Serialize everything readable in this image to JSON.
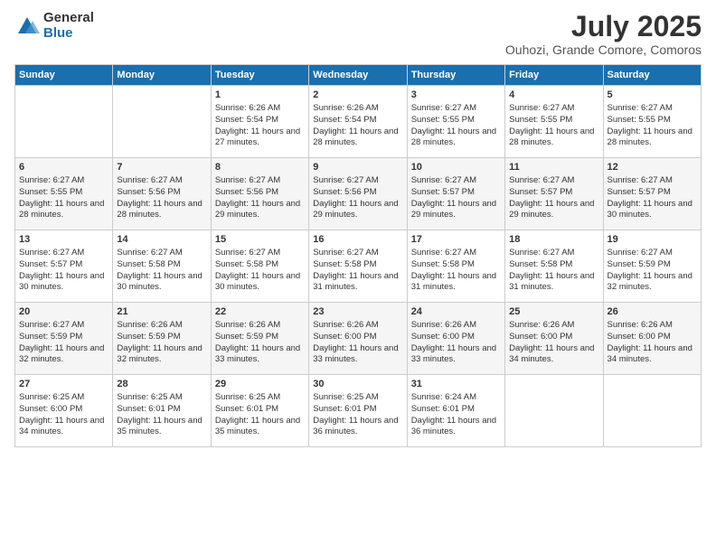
{
  "logo": {
    "general": "General",
    "blue": "Blue"
  },
  "title": "July 2025",
  "subtitle": "Ouhozi, Grande Comore, Comoros",
  "days_of_week": [
    "Sunday",
    "Monday",
    "Tuesday",
    "Wednesday",
    "Thursday",
    "Friday",
    "Saturday"
  ],
  "weeks": [
    [
      {
        "day": "",
        "info": ""
      },
      {
        "day": "",
        "info": ""
      },
      {
        "day": "1",
        "info": "Sunrise: 6:26 AM\nSunset: 5:54 PM\nDaylight: 11 hours and 27 minutes."
      },
      {
        "day": "2",
        "info": "Sunrise: 6:26 AM\nSunset: 5:54 PM\nDaylight: 11 hours and 28 minutes."
      },
      {
        "day": "3",
        "info": "Sunrise: 6:27 AM\nSunset: 5:55 PM\nDaylight: 11 hours and 28 minutes."
      },
      {
        "day": "4",
        "info": "Sunrise: 6:27 AM\nSunset: 5:55 PM\nDaylight: 11 hours and 28 minutes."
      },
      {
        "day": "5",
        "info": "Sunrise: 6:27 AM\nSunset: 5:55 PM\nDaylight: 11 hours and 28 minutes."
      }
    ],
    [
      {
        "day": "6",
        "info": "Sunrise: 6:27 AM\nSunset: 5:55 PM\nDaylight: 11 hours and 28 minutes."
      },
      {
        "day": "7",
        "info": "Sunrise: 6:27 AM\nSunset: 5:56 PM\nDaylight: 11 hours and 28 minutes."
      },
      {
        "day": "8",
        "info": "Sunrise: 6:27 AM\nSunset: 5:56 PM\nDaylight: 11 hours and 29 minutes."
      },
      {
        "day": "9",
        "info": "Sunrise: 6:27 AM\nSunset: 5:56 PM\nDaylight: 11 hours and 29 minutes."
      },
      {
        "day": "10",
        "info": "Sunrise: 6:27 AM\nSunset: 5:57 PM\nDaylight: 11 hours and 29 minutes."
      },
      {
        "day": "11",
        "info": "Sunrise: 6:27 AM\nSunset: 5:57 PM\nDaylight: 11 hours and 29 minutes."
      },
      {
        "day": "12",
        "info": "Sunrise: 6:27 AM\nSunset: 5:57 PM\nDaylight: 11 hours and 30 minutes."
      }
    ],
    [
      {
        "day": "13",
        "info": "Sunrise: 6:27 AM\nSunset: 5:57 PM\nDaylight: 11 hours and 30 minutes."
      },
      {
        "day": "14",
        "info": "Sunrise: 6:27 AM\nSunset: 5:58 PM\nDaylight: 11 hours and 30 minutes."
      },
      {
        "day": "15",
        "info": "Sunrise: 6:27 AM\nSunset: 5:58 PM\nDaylight: 11 hours and 30 minutes."
      },
      {
        "day": "16",
        "info": "Sunrise: 6:27 AM\nSunset: 5:58 PM\nDaylight: 11 hours and 31 minutes."
      },
      {
        "day": "17",
        "info": "Sunrise: 6:27 AM\nSunset: 5:58 PM\nDaylight: 11 hours and 31 minutes."
      },
      {
        "day": "18",
        "info": "Sunrise: 6:27 AM\nSunset: 5:58 PM\nDaylight: 11 hours and 31 minutes."
      },
      {
        "day": "19",
        "info": "Sunrise: 6:27 AM\nSunset: 5:59 PM\nDaylight: 11 hours and 32 minutes."
      }
    ],
    [
      {
        "day": "20",
        "info": "Sunrise: 6:27 AM\nSunset: 5:59 PM\nDaylight: 11 hours and 32 minutes."
      },
      {
        "day": "21",
        "info": "Sunrise: 6:26 AM\nSunset: 5:59 PM\nDaylight: 11 hours and 32 minutes."
      },
      {
        "day": "22",
        "info": "Sunrise: 6:26 AM\nSunset: 5:59 PM\nDaylight: 11 hours and 33 minutes."
      },
      {
        "day": "23",
        "info": "Sunrise: 6:26 AM\nSunset: 6:00 PM\nDaylight: 11 hours and 33 minutes."
      },
      {
        "day": "24",
        "info": "Sunrise: 6:26 AM\nSunset: 6:00 PM\nDaylight: 11 hours and 33 minutes."
      },
      {
        "day": "25",
        "info": "Sunrise: 6:26 AM\nSunset: 6:00 PM\nDaylight: 11 hours and 34 minutes."
      },
      {
        "day": "26",
        "info": "Sunrise: 6:26 AM\nSunset: 6:00 PM\nDaylight: 11 hours and 34 minutes."
      }
    ],
    [
      {
        "day": "27",
        "info": "Sunrise: 6:25 AM\nSunset: 6:00 PM\nDaylight: 11 hours and 34 minutes."
      },
      {
        "day": "28",
        "info": "Sunrise: 6:25 AM\nSunset: 6:01 PM\nDaylight: 11 hours and 35 minutes."
      },
      {
        "day": "29",
        "info": "Sunrise: 6:25 AM\nSunset: 6:01 PM\nDaylight: 11 hours and 35 minutes."
      },
      {
        "day": "30",
        "info": "Sunrise: 6:25 AM\nSunset: 6:01 PM\nDaylight: 11 hours and 36 minutes."
      },
      {
        "day": "31",
        "info": "Sunrise: 6:24 AM\nSunset: 6:01 PM\nDaylight: 11 hours and 36 minutes."
      },
      {
        "day": "",
        "info": ""
      },
      {
        "day": "",
        "info": ""
      }
    ]
  ]
}
